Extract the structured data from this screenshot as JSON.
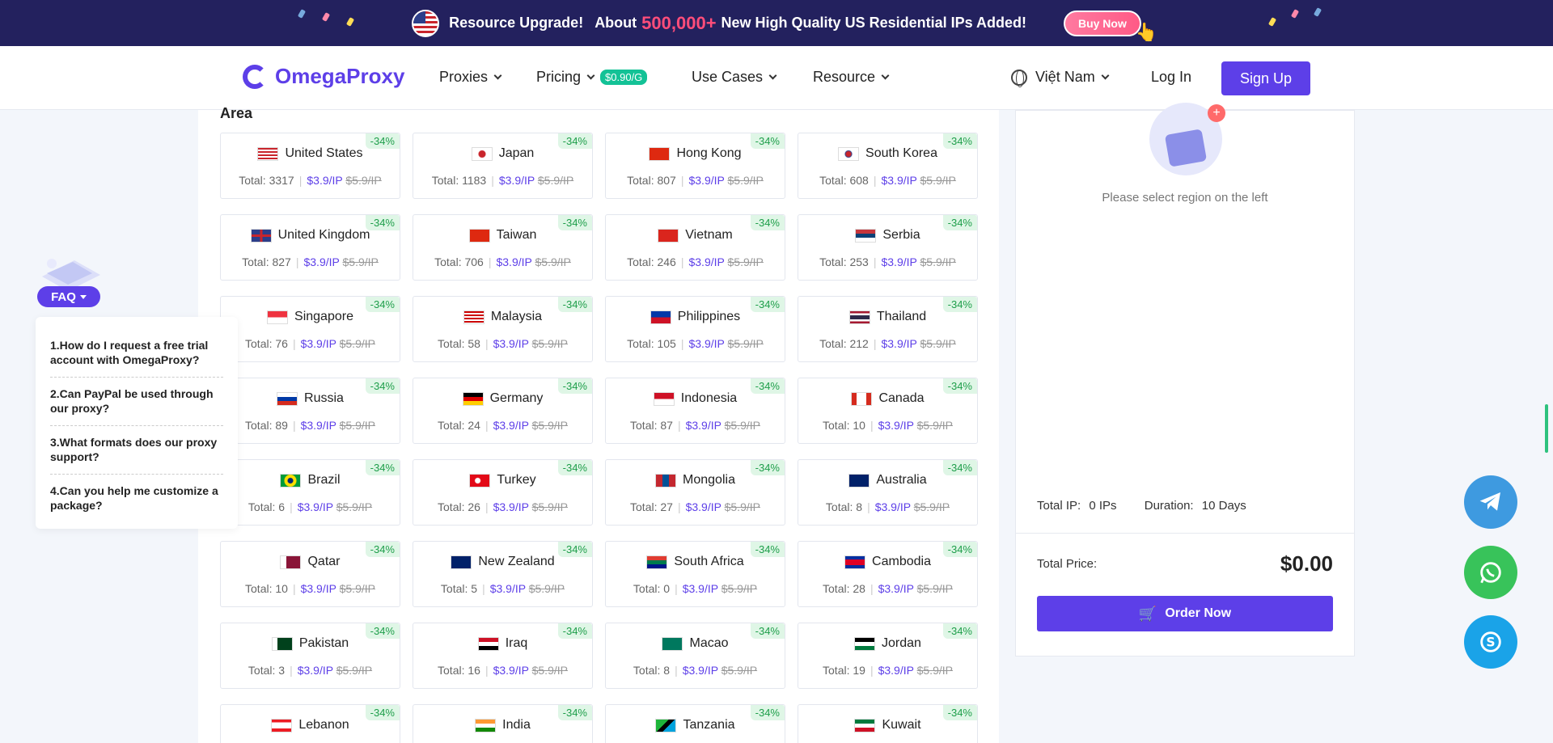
{
  "banner": {
    "text1": "Resource Upgrade!",
    "text2": "About",
    "highlight": "500,000+",
    "text3": "New High Quality US Residential IPs Added!",
    "buy_label": "Buy Now"
  },
  "nav": {
    "logo": "OmegaProxy",
    "items": [
      "Proxies",
      "Pricing",
      "Use Cases",
      "Resource"
    ],
    "price_badge": "$0.90/G",
    "language": "Việt Nam",
    "login": "Log In",
    "signup": "Sign Up"
  },
  "area": {
    "title": "Area",
    "discount": "-34%",
    "price": "$3.9/IP",
    "old_price": "$5.9/IP",
    "total_prefix": "Total: ",
    "regions": [
      {
        "name": "United States",
        "total": "3317",
        "flag": "us"
      },
      {
        "name": "Japan",
        "total": "1183",
        "flag": "jp"
      },
      {
        "name": "Hong Kong",
        "total": "807",
        "flag": "hk"
      },
      {
        "name": "South Korea",
        "total": "608",
        "flag": "kr"
      },
      {
        "name": "United Kingdom",
        "total": "827",
        "flag": "gb"
      },
      {
        "name": "Taiwan",
        "total": "706",
        "flag": "tw"
      },
      {
        "name": "Vietnam",
        "total": "246",
        "flag": "vn"
      },
      {
        "name": "Serbia",
        "total": "253",
        "flag": "rs"
      },
      {
        "name": "Singapore",
        "total": "76",
        "flag": "sg"
      },
      {
        "name": "Malaysia",
        "total": "58",
        "flag": "my"
      },
      {
        "name": "Philippines",
        "total": "105",
        "flag": "ph"
      },
      {
        "name": "Thailand",
        "total": "212",
        "flag": "th"
      },
      {
        "name": "Russia",
        "total": "89",
        "flag": "ru"
      },
      {
        "name": "Germany",
        "total": "24",
        "flag": "de"
      },
      {
        "name": "Indonesia",
        "total": "87",
        "flag": "id"
      },
      {
        "name": "Canada",
        "total": "10",
        "flag": "ca"
      },
      {
        "name": "Brazil",
        "total": "6",
        "flag": "br"
      },
      {
        "name": "Turkey",
        "total": "26",
        "flag": "tr"
      },
      {
        "name": "Mongolia",
        "total": "27",
        "flag": "mn"
      },
      {
        "name": "Australia",
        "total": "8",
        "flag": "au"
      },
      {
        "name": "Qatar",
        "total": "10",
        "flag": "qa"
      },
      {
        "name": "New Zealand",
        "total": "5",
        "flag": "nz"
      },
      {
        "name": "South Africa",
        "total": "0",
        "flag": "za"
      },
      {
        "name": "Cambodia",
        "total": "28",
        "flag": "kh"
      },
      {
        "name": "Pakistan",
        "total": "3",
        "flag": "pk"
      },
      {
        "name": "Iraq",
        "total": "16",
        "flag": "iq"
      },
      {
        "name": "Macao",
        "total": "8",
        "flag": "mo"
      },
      {
        "name": "Jordan",
        "total": "19",
        "flag": "jo"
      },
      {
        "name": "Lebanon",
        "total": "",
        "flag": "lb"
      },
      {
        "name": "India",
        "total": "",
        "flag": "in"
      },
      {
        "name": "Tanzania",
        "total": "",
        "flag": "tz"
      },
      {
        "name": "Kuwait",
        "total": "",
        "flag": "kw"
      }
    ]
  },
  "cart": {
    "empty_text": "Please select region on the left",
    "total_ip_label": "Total IP:",
    "total_ip_value": "0 IPs",
    "duration_label": "Duration:",
    "duration_value": "10 Days",
    "total_price_label": "Total Price:",
    "total_price_value": "$0.00",
    "order_label": "Order Now"
  },
  "faq": {
    "button": "FAQ",
    "questions": [
      "1.How do I request a free trial account with OmegaProxy?",
      "2.Can PayPal be used through our proxy?",
      "3.What formats does our proxy support?",
      "4.Can you help me customize a package?"
    ]
  },
  "icons": {
    "telegram": "telegram-icon",
    "whatsapp": "whatsapp-icon",
    "skype": "skype-icon",
    "cart": "cart-icon",
    "globe": "globe-icon"
  },
  "colors": {
    "brand": "#5d3fe8",
    "banner_bg": "#23215e",
    "discount_bg": "#dff6e6",
    "discount_text": "#1e9e4a"
  }
}
